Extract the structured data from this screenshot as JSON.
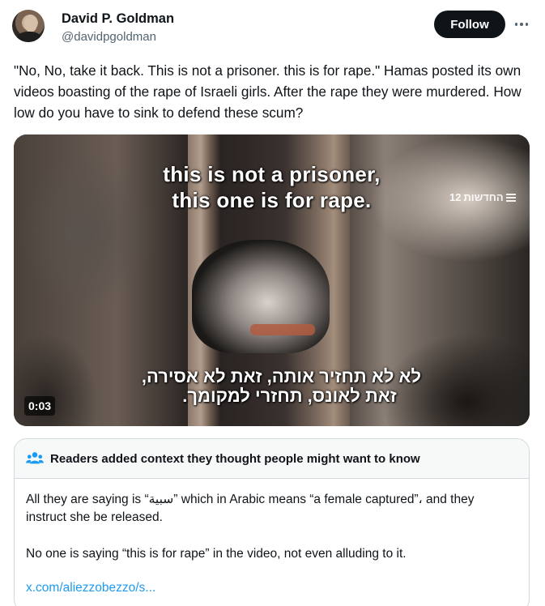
{
  "author": {
    "name": "David P. Goldman",
    "handle": "@davidpgoldman",
    "follow_label": "Follow",
    "more_icon": "more-horizontal-icon"
  },
  "tweet": {
    "text": "\"No, No, take it back. This is not a prisoner. this is for rape.\" Hamas posted its own videos boasting of the rape of Israeli girls. After the rape they were murdered. How low do you have to sink to defend these scum?"
  },
  "video": {
    "subtitle_en_line1": "this is not a prisoner,",
    "subtitle_en_line2": "this one is for rape.",
    "subtitle_he_line1": "לא לא תחזיר אותה, זאת לא אסירה,",
    "subtitle_he_line2": "זאת לאונס, תחזרי למקומך.",
    "channel_logo": "החדשות",
    "channel_number": "12",
    "duration": "0:03"
  },
  "community_note": {
    "icon": "people-icon",
    "icon_color": "#1d9bf0",
    "title": "Readers added context they thought people might want to know",
    "paragraph1": "All they are saying is “سبية” which in Arabic means “a female captured”، and they instruct she be released.",
    "paragraph2": "No one is saying “this is for rape” in the video, not even alluding to it.",
    "link": "x.com/aliezzobezzo/s..."
  },
  "colors": {
    "text_primary": "#0f1419",
    "text_secondary": "#536471",
    "link": "#1d9bf0",
    "border": "#cfd9de",
    "follow_bg": "#0f1419"
  }
}
